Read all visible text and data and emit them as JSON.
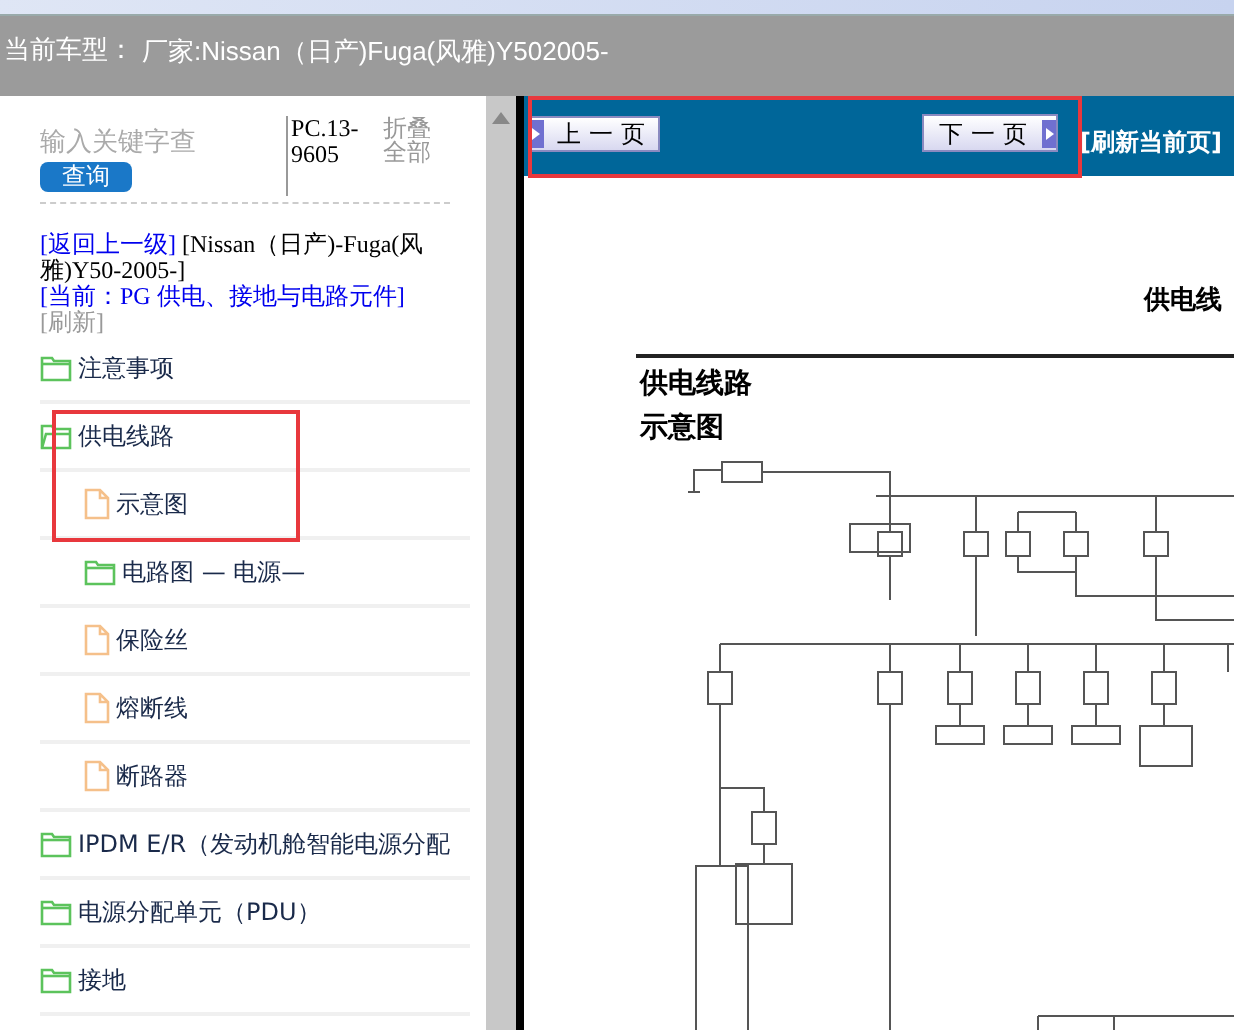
{
  "header": {
    "label": "当前车型：",
    "value": "厂家:Nissan（日产)Fuga(风雅)Y502005-"
  },
  "sidebar": {
    "search": {
      "placeholder": "输入关键字查"
    },
    "search_button": "查询",
    "code": "PC.13-9605",
    "collapse_all": "折叠全部",
    "back_link": "[返回上一级]",
    "model_path": "[Nissan（日产)-Fuga(风雅)Y50-2005-]",
    "current": "[当前：PG 供电、接地与电路元件]",
    "refresh": "[刷新]",
    "tree": [
      {
        "kind": "folder",
        "label": "注意事项",
        "expanded": false
      },
      {
        "kind": "folder",
        "label": "供电线路",
        "expanded": true,
        "children": [
          {
            "kind": "file",
            "label": "示意图"
          },
          {
            "kind": "folder",
            "label": "电路图 — 电源—",
            "expanded": false
          },
          {
            "kind": "file",
            "label": "保险丝"
          },
          {
            "kind": "file",
            "label": "熔断线"
          },
          {
            "kind": "file",
            "label": "断路器"
          }
        ]
      },
      {
        "kind": "folder",
        "label": "IPDM E/R（发动机舱智能电源分配",
        "expanded": false
      },
      {
        "kind": "folder",
        "label": "电源分配单元（PDU）",
        "expanded": false
      },
      {
        "kind": "folder",
        "label": "接地",
        "expanded": false
      }
    ]
  },
  "toolbar": {
    "prev": "上 一 页",
    "next": "下 一 页",
    "refresh": "[刷新当前页]"
  },
  "document": {
    "page_title": "供电线",
    "heading": "供电线路",
    "subheading": "示意图"
  }
}
